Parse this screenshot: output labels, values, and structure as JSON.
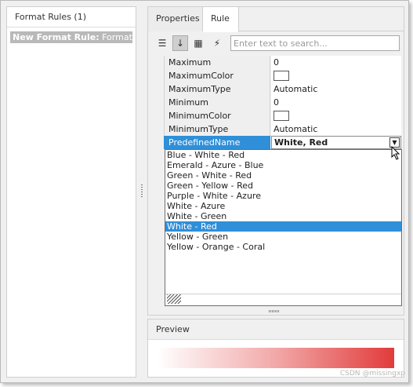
{
  "left_panel": {
    "header": "Format Rules (1)",
    "item_prefix": "New Format Rule:",
    "item_name": "FormatCor"
  },
  "tabs": [
    {
      "label": "Properties"
    },
    {
      "label": "Rule"
    }
  ],
  "toolbar": {
    "search_placeholder": "Enter text to search..."
  },
  "properties": [
    {
      "name": "Maximum",
      "value": "0"
    },
    {
      "name": "MaximumColor",
      "value": ""
    },
    {
      "name": "MaximumType",
      "value": "Automatic"
    },
    {
      "name": "Minimum",
      "value": "0"
    },
    {
      "name": "MinimumColor",
      "value": ""
    },
    {
      "name": "MinimumType",
      "value": "Automatic"
    },
    {
      "name": "PredefinedName",
      "value": "White, Red"
    }
  ],
  "dropdown": {
    "options": [
      "Blue - White - Red",
      "Emerald - Azure - Blue",
      "Green - White - Red",
      "Green - Yellow - Red",
      "Purple - White - Azure",
      "White - Azure",
      "White - Green",
      "White - Red",
      "Yellow - Green",
      "Yellow - Orange - Coral"
    ],
    "highlighted": "White - Red"
  },
  "preview": {
    "header": "Preview",
    "gradient_start": "#ffffff",
    "gradient_end": "#e23b3b"
  },
  "watermark": "CSDN @missingxp",
  "colors": {
    "selection": "#2f8fd8",
    "left_item_bg": "#b9b9b9"
  }
}
